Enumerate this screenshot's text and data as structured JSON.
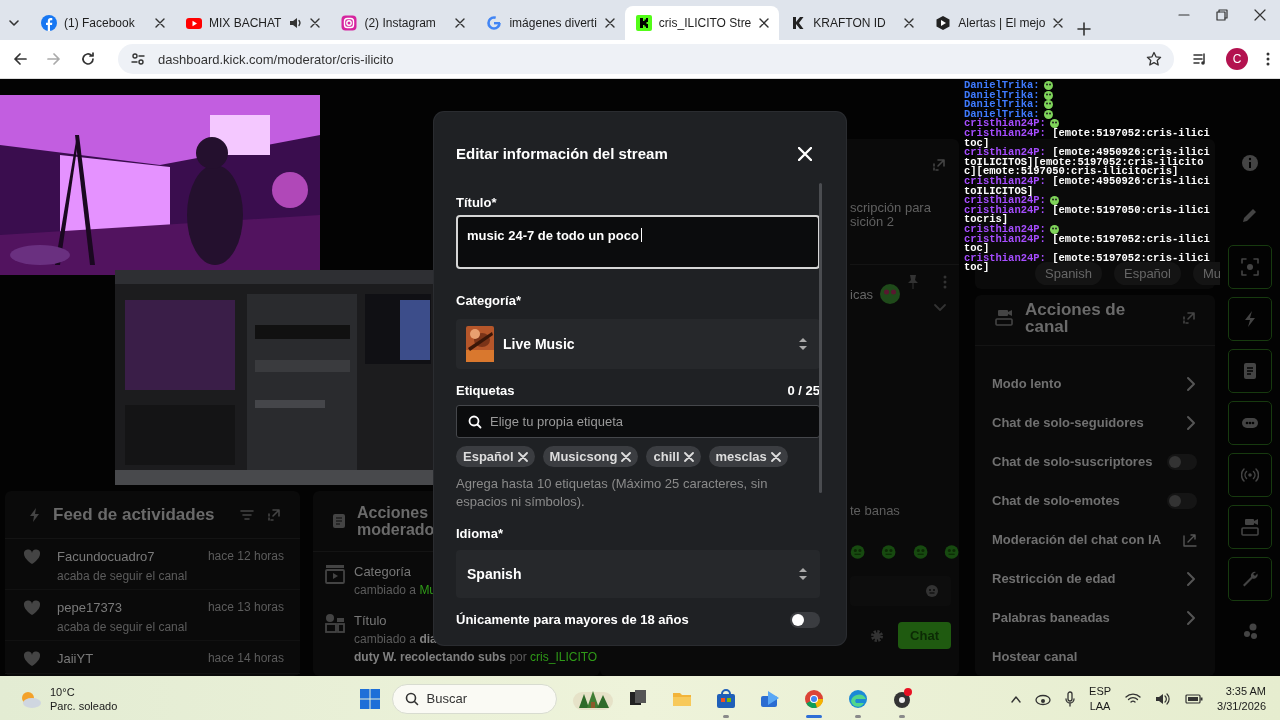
{
  "browser": {
    "tabs": [
      {
        "label": "(1) Facebook",
        "selected": false,
        "audio": false
      },
      {
        "label": "MIX BACHAT",
        "selected": false,
        "audio": true
      },
      {
        "label": "(2) Instagram",
        "selected": false,
        "audio": false
      },
      {
        "label": "imágenes diverti",
        "selected": false,
        "audio": false
      },
      {
        "label": "cris_ILICITO Stre",
        "selected": true,
        "audio": false
      },
      {
        "label": "KRAFTON ID",
        "selected": false,
        "audio": false
      },
      {
        "label": "Alertas | El mejo",
        "selected": false,
        "audio": false
      }
    ],
    "url": "dashboard.kick.com/moderator/cris-ilicito",
    "profile_initial": "C"
  },
  "feed": {
    "title": "Feed de actividades",
    "items": [
      {
        "user": "Facundocuadro7",
        "action": "acaba de seguir el canal",
        "time": "hace 12 horas"
      },
      {
        "user": "pepe17373",
        "action": "acaba de seguir el canal",
        "time": "hace 13 horas"
      },
      {
        "user": "JaiiYT",
        "time": "hace 14 horas"
      }
    ]
  },
  "moderator_actions": {
    "title": "Acciones moderado",
    "items": [
      {
        "kind": "category",
        "label": "Categoría",
        "lines": [
          [
            "cambiado a ",
            "Mu"
          ]
        ]
      },
      {
        "kind": "title",
        "label": "Título",
        "lines": [
          [
            "cambiado a ",
            "dia"
          ],
          [
            "duty W. recolectando subs ",
            "por ",
            "cris_ILICITO"
          ]
        ]
      }
    ]
  },
  "chat_panel": {
    "pinned_lines": [
      "scripción para",
      "sición 2"
    ],
    "pinned_message": "icas",
    "message": "te banas",
    "send_button": "Chat"
  },
  "stream_info": {
    "tags": [
      "Spanish",
      "Español",
      "Mu"
    ]
  },
  "channel_actions": {
    "title": "Acciones de canal",
    "items": [
      {
        "label": "Modo lento",
        "kind": "submenu"
      },
      {
        "label": "Chat de solo-seguidores",
        "kind": "submenu"
      },
      {
        "label": "Chat de solo-suscriptores",
        "kind": "toggle",
        "on": false
      },
      {
        "label": "Chat de solo-emotes",
        "kind": "toggle",
        "on": false
      },
      {
        "label": "Moderación del chat con IA",
        "kind": "external"
      },
      {
        "label": "Restricción de edad",
        "kind": "submenu"
      },
      {
        "label": "Palabras baneadas",
        "kind": "submenu"
      },
      {
        "label": "Hostear canal",
        "kind": "plain"
      }
    ]
  },
  "chat_overlay": {
    "messages": [
      {
        "user": "DanielTrika:",
        "color": "#3f7bff",
        "emote": true
      },
      {
        "user": "DanielTrika:",
        "color": "#3f7bff",
        "emote": true
      },
      {
        "user": "DanielTrika:",
        "color": "#3f7bff",
        "emote": true
      },
      {
        "user": "DanielTrika:",
        "color": "#3f7bff",
        "emote": true
      },
      {
        "user": "cristhian24P:",
        "color": "#a64dff",
        "emote": true
      },
      {
        "user": "cristhian24P:",
        "color": "#a64dff",
        "text": "[emote:5197052:cris-ilicitoc]"
      },
      {
        "user": "cristhian24P:",
        "color": "#a64dff",
        "text": "[emote:4950926:cris-ilicitoILICITOS][emote:5197052:cris-ilicitoc][emote:5197050:cris-ilicitocris]"
      },
      {
        "user": "cristhian24P:",
        "color": "#a64dff",
        "text": "[emote:4950926:cris-ilicitoILICITOS]"
      },
      {
        "user": "cristhian24P:",
        "color": "#a64dff",
        "emote": true
      },
      {
        "user": "cristhian24P:",
        "color": "#a64dff",
        "text": "[emote:5197050:cris-ilicitocris]"
      },
      {
        "user": "cristhian24P:",
        "color": "#a64dff",
        "emote": true
      },
      {
        "user": "cristhian24P:",
        "color": "#a64dff",
        "text": "[emote:5197052:cris-ilicitoc]"
      },
      {
        "user": "cristhian24P:",
        "color": "#a64dff",
        "text": "[emote:5197052:cris-ilicitoc]"
      }
    ]
  },
  "modal": {
    "title": "Editar información del stream",
    "title_label": "Título*",
    "title_value": "music 24-7 de todo un poco",
    "category_label": "Categoría*",
    "category": "Live Music",
    "tags_label": "Etiquetas",
    "tags_count": "0 / 25",
    "tag_placeholder": "Elige tu propia etiqueta",
    "tags": [
      "Español",
      "Musicsong",
      "chill",
      "mesclas"
    ],
    "tags_hint": "Agrega hasta 10 etiquetas (Máximo 25 caracteres, sin espacios ni símbolos).",
    "language_label": "Idioma*",
    "language": "Spanish",
    "mature_label": "Únicamente para mayores de 18 años",
    "mature_on": false
  },
  "taskbar": {
    "weather_temp": "10°C",
    "weather_text": "Parc. soleado",
    "search_label": "Buscar",
    "apps": [
      {
        "kind": "taskview",
        "running": false,
        "active": false
      },
      {
        "kind": "files",
        "running": false,
        "active": false
      },
      {
        "kind": "store",
        "running": true,
        "active": false
      },
      {
        "kind": "mail",
        "running": false,
        "active": false
      },
      {
        "kind": "chrome",
        "running": true,
        "active": true
      },
      {
        "kind": "edge",
        "running": true,
        "active": false
      },
      {
        "kind": "recorder",
        "running": true,
        "active": false
      }
    ],
    "language": "ESP",
    "region": "LAA",
    "time": "3:35 AM",
    "date": "3/31/2026"
  }
}
